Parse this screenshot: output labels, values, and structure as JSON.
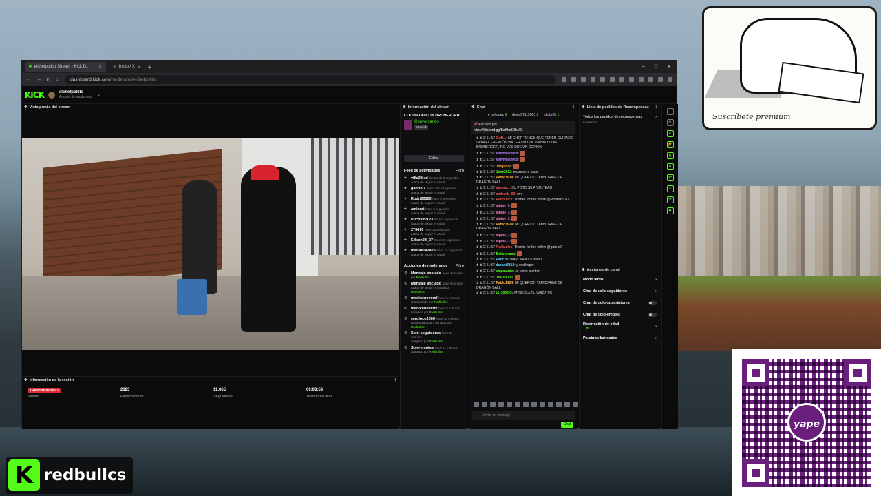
{
  "browser": {
    "tab1": "elchefpollito Stream - Kick D...",
    "tab2": "Inicio / X",
    "new_tab": "+",
    "url_prefix": "dashboard.kick.com",
    "url_path": "/moderator/elchefpollito",
    "ctl_min": "–",
    "ctl_max": "□",
    "ctl_close": "✕",
    "back": "←",
    "forward": "→",
    "reload": "↻",
    "home": "⌂"
  },
  "kick": {
    "logo": "KICK",
    "channel": "elchefpollito",
    "role": "Acceso de moderador"
  },
  "preview": {
    "title": "Vista previa del stream"
  },
  "session": {
    "title": "Información de la sesión",
    "status": "TRANSMITIENDO",
    "status_label": "Sesión",
    "spectators": "2183",
    "spectators_label": "Espectadores",
    "followers": "11.065",
    "followers_label": "Seguidores",
    "live_time": "00:08:53",
    "live_time_label": "Tiempo en vivo"
  },
  "info": {
    "title": "Información del stream",
    "stream_title": "COCINADO CON BRUNERGER",
    "category": "Conversando",
    "language": "Spanish",
    "edit": "Editar"
  },
  "activity": {
    "title": "Feed de actividades",
    "filter": "Filtro",
    "items": [
      {
        "name": "villa28.xd",
        "time": "dentro de 5 segundos",
        "desc": "acaba de seguir el canal"
      },
      {
        "name": "gabriel7",
        "time": "dentro de 2 segundos",
        "desc": "acaba de seguir el canal"
      },
      {
        "name": "Rodri00520",
        "time": "hace 0 segundos",
        "desc": "acaba de seguir el canal"
      },
      {
        "name": "amicuri",
        "time": "hace 2 segundos",
        "desc": "acaba de seguir el canal"
      },
      {
        "name": "Puchichi123",
        "time": "hace 9 segundos",
        "desc": "acaba de seguir el canal"
      },
      {
        "name": "273476",
        "time": "hace 12 segundos",
        "desc": "acaba de seguir el canal"
      },
      {
        "name": "Edson24_07",
        "time": "hace 16 segundos",
        "desc": "acaba de seguir el canal"
      },
      {
        "name": "matias142425",
        "time": "hace 16 segundos",
        "desc": "acaba de seguir el canal"
      }
    ]
  },
  "modactions": {
    "title": "Acciones de moderador",
    "filter": "Filtro",
    "items": [
      {
        "name": "Mensaje anclado",
        "time": "hace 4 minutos",
        "desc": "por",
        "by": "Redbullcs"
      },
      {
        "name": "Mensaje anclado",
        "time": "hace 4 minutos",
        "desc": "acaba de seguir el canal por",
        "by": "Redbullcs"
      },
      {
        "name": "mediceneverol",
        "time": "hace 5 minutos",
        "desc": "desbaneado por",
        "by": "Redbullcs"
      },
      {
        "name": "mediceneverol",
        "time": "hace 5 minutos",
        "desc": "baneado por",
        "by": "Redbullcs"
      },
      {
        "name": "sergioco2006",
        "time": "hace 15 minutos",
        "desc": "suspendido por 5 minutos por",
        "by": "Redbullcs"
      },
      {
        "name": "Solo-seguidores",
        "time": "hace 31 minutos",
        "desc": "apagado por",
        "by": "Redbullcs"
      },
      {
        "name": "Solo-emotes",
        "time": "hace 31 minutos",
        "desc": "apagado por",
        "by": "Redbullcs"
      }
    ]
  },
  "chat": {
    "title": "Chat",
    "top1": "ozhadez",
    "top1_count": "6",
    "top2": "david07112003",
    "top2_count": "2",
    "top3": "lulubr05",
    "top3_count": "1",
    "pinned_by": "Anclado por",
    "pinned_link": "https://discord.gg/BeKhaG8cMC",
    "messages": [
      {
        "time": "11:57",
        "user": "Griff...",
        "cls": "u1",
        "text": "MI CHEF TIENES QUE TENER CUIDADO VAYA EL FRENTÓN HACER UN COCINANDO CON BRUNERGER, NO VES QUE UN COPIÓN"
      },
      {
        "time": "11:57",
        "user": "kiriviwwowcx",
        "cls": "u2",
        "text": ""
      },
      {
        "time": "11:57",
        "user": "kiriviwwowcx",
        "cls": "u2",
        "text": ""
      },
      {
        "time": "11:57",
        "user": "Jorgitollo",
        "cls": "u4",
        "text": ""
      },
      {
        "time": "11:57",
        "user": "Jonz2812",
        "cls": "u3",
        "text": "muestra la casa"
      },
      {
        "time": "11:57",
        "user": "Pablo1924",
        "cls": "u4",
        "text": "MI QUERIDO TAMBORINE DE DRAGÓN BALL"
      },
      {
        "time": "11:57",
        "user": "alansa...",
        "cls": "u1",
        "text": "SU POTO SE A VOLTEAO"
      },
      {
        "time": "11:57",
        "user": "andreab_00",
        "cls": "u1",
        "text": "cmr"
      },
      {
        "time": "11:57",
        "user": "Redbullcs",
        "cls": "u1",
        "text": "Thanks for the follow @Rodri00520"
      },
      {
        "time": "11:57",
        "user": "sipibe_3",
        "cls": "u6",
        "text": ""
      },
      {
        "time": "11:57",
        "user": "sipibe_3",
        "cls": "u6",
        "text": ""
      },
      {
        "time": "11:57",
        "user": "sipibe_3",
        "cls": "u6",
        "text": ""
      },
      {
        "time": "11:57",
        "user": "Pablo1924",
        "cls": "u4",
        "text": "MI QUERIDO TAMBORINE DE DRAGÓN BALL"
      },
      {
        "time": "11:57",
        "user": "sipibe_3",
        "cls": "u6",
        "text": ""
      },
      {
        "time": "11:57",
        "user": "sipibe_3",
        "cls": "u6",
        "text": ""
      },
      {
        "time": "11:57",
        "user": "Redbullcs",
        "cls": "u1",
        "text": "Thanks for the follow @gabriel7"
      },
      {
        "time": "11:57",
        "user": "Bellotorock",
        "cls": "u3",
        "text": ""
      },
      {
        "time": "11:57",
        "user": "Estic76",
        "cls": "u5",
        "text": "MARCIANOOOOOO"
      },
      {
        "time": "11:57",
        "user": "durant3812",
        "cls": "u5",
        "text": "y cristhoper"
      },
      {
        "time": "11:57",
        "user": "eojamarde",
        "cls": "u3",
        "text": "se viene planton"
      },
      {
        "time": "11:57",
        "user": "JesusLeal",
        "cls": "u3",
        "text": ""
      },
      {
        "time": "11:57",
        "user": "Pablo1924",
        "cls": "u4",
        "text": "MI QUERIDO TAMBORINE DE DRAGÓN BALL"
      },
      {
        "time": "11:57",
        "user": "Li_2009IC",
        "cls": "u3",
        "text": "ARREGLA TU WBDA PS"
      }
    ],
    "input_placeholder": "Enviar un mensaje",
    "send": "Chat"
  },
  "rewards": {
    "title": "Lista de pedidos de Recompensas",
    "all": "Todos los pedidos de recompensas",
    "count": "0 pedidos"
  },
  "channel_actions": {
    "title": "Acciones de canal",
    "items": [
      {
        "label": "Modo lento",
        "kind": "arrow"
      },
      {
        "label": "Chat de solo-seguidores",
        "kind": "arrow"
      },
      {
        "label": "Chat de solo-suscriptores",
        "kind": "toggle"
      },
      {
        "label": "Chat de solo-emotes",
        "kind": "toggle"
      },
      {
        "label": "Restricción de edad",
        "sub": "1 m",
        "kind": "arrow"
      },
      {
        "label": "Palabras baneadas",
        "kind": "arrow"
      }
    ]
  },
  "overlay": {
    "brand": "redbullcs",
    "brand_icon": "K",
    "qr_badge": "yape",
    "sticker_sign": "Suscríbete premium"
  },
  "colors": {
    "kick_green": "#53fc18",
    "live_red": "#e02c38",
    "yape_purple": "#6b1f7c"
  }
}
